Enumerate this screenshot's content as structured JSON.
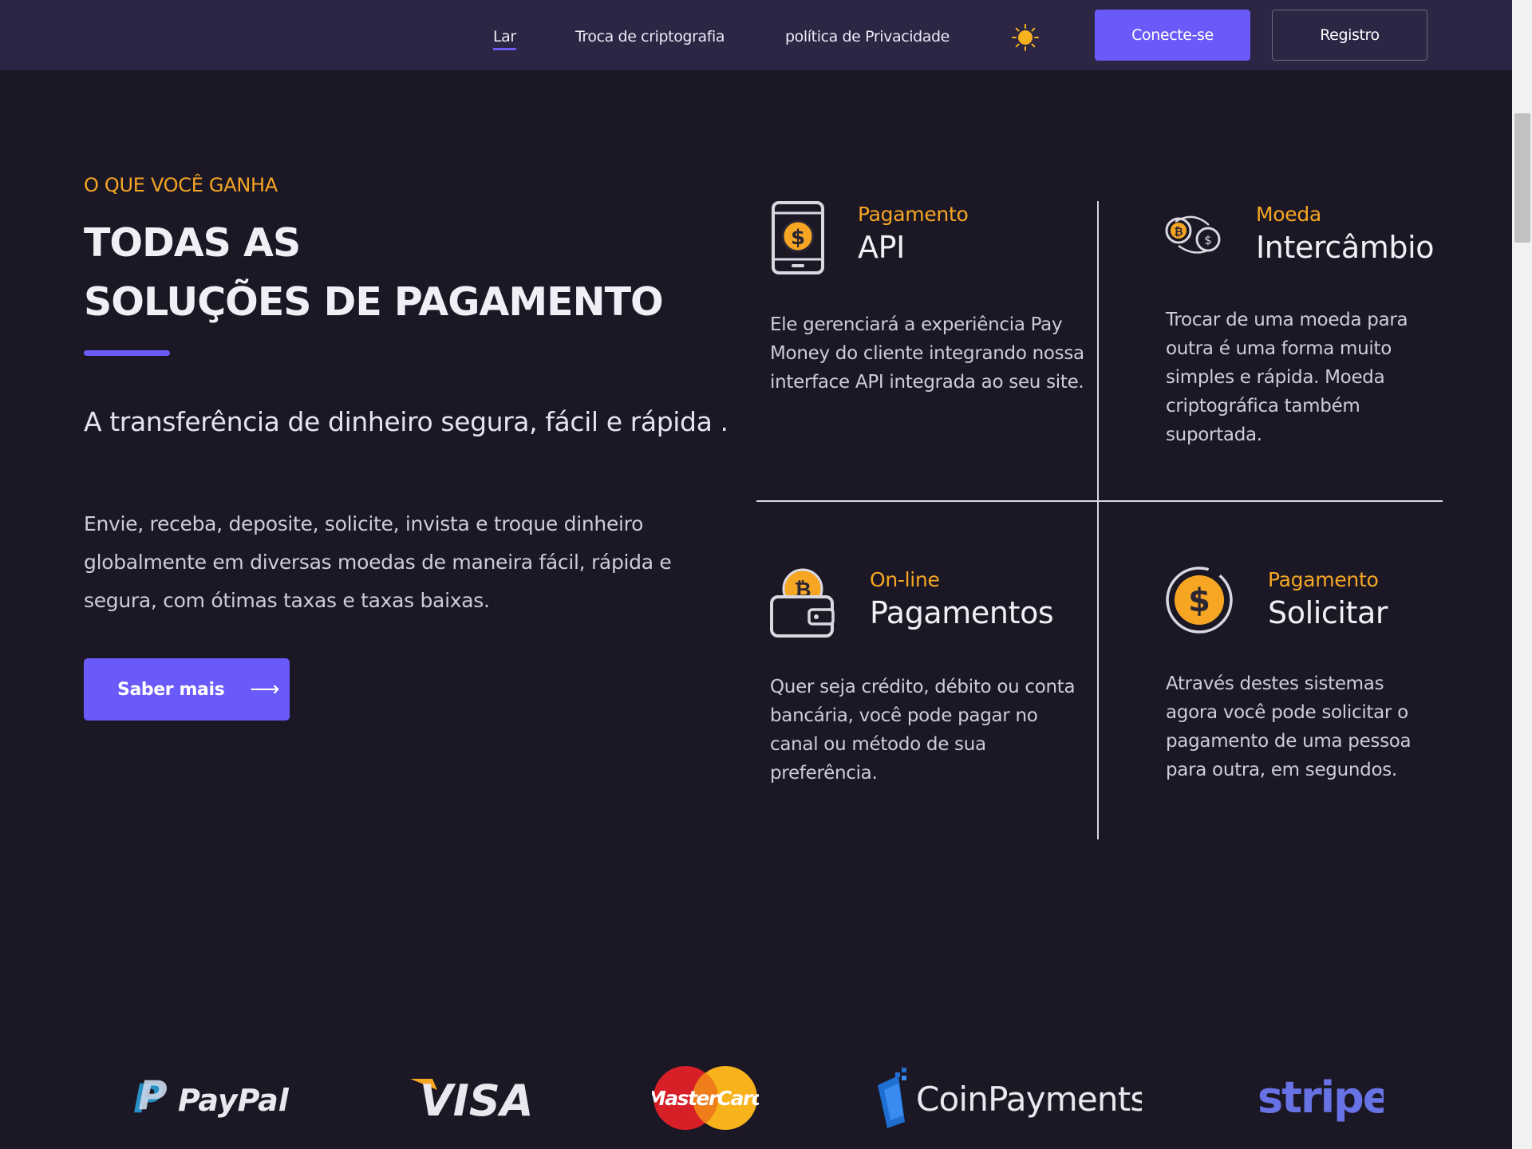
{
  "nav": {
    "links": [
      "Lar",
      "Troca de criptografia",
      "política de Privacidade"
    ],
    "login_label": "Conecte-se",
    "register_label": "Registro"
  },
  "hero": {
    "eyebrow": "O QUE VOCÊ GANHA",
    "headline_line1": "TODAS AS",
    "headline_line2": "SOLUÇÕES DE PAGAMENTO",
    "subhead": "A transferência de dinheiro segura, fácil e rápida .",
    "description": "Envie, receba, deposite, solicite, invista e troque dinheiro globalmente em diversas moedas de maneira fácil, rápida e segura, com ótimas taxas e taxas baixas.",
    "cta_label": "Saber mais",
    "cta_arrow": "⟶"
  },
  "features": [
    {
      "kicker": "Pagamento",
      "title": "API",
      "icon": "phone-dollar-icon",
      "description": "Ele gerenciará a experiência Pay Money do cliente integrando nossa interface API integrada ao seu site."
    },
    {
      "kicker": "Moeda",
      "title": "Intercâmbio",
      "icon": "coin-exchange-icon",
      "description": "Trocar de uma moeda para outra é uma forma muito simples e rápida. Moeda criptográfica também suportada."
    },
    {
      "kicker": "On-line",
      "title": "Pagamentos",
      "icon": "wallet-bitcoin-icon",
      "description": "Quer seja crédito, débito ou conta bancária, você pode pagar no canal ou método de sua preferência."
    },
    {
      "kicker": "Pagamento",
      "title": "Solicitar",
      "icon": "dollar-coin-icon",
      "description": "Através destes sistemas agora você pode solicitar o pagamento de uma pessoa para outra, em segundos."
    }
  ],
  "partners": {
    "paypal": "PayPal",
    "visa": "VISA",
    "mastercard": "MasterCard",
    "coinpayments": "CoinPayments",
    "stripe": "stripe"
  },
  "colors": {
    "background": "#1b1725",
    "nav_background": "#2c2544",
    "accent": "#6a5af9",
    "highlight": "#f6a623"
  }
}
